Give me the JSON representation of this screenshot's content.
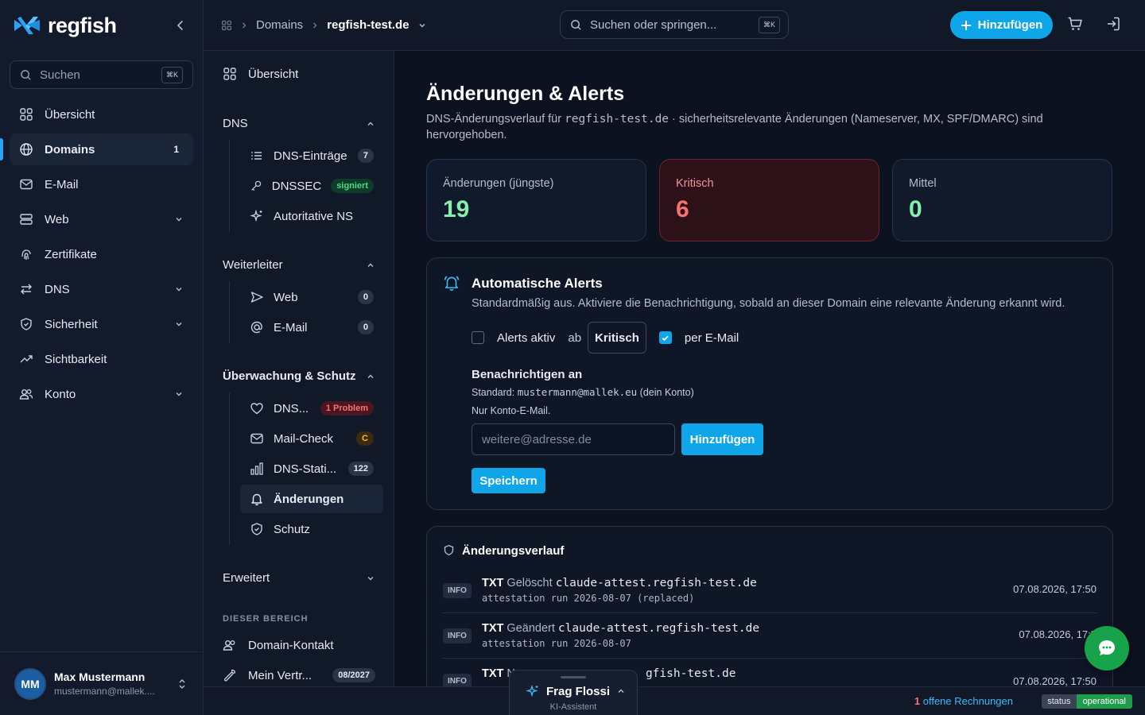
{
  "app": {
    "logo_text": "regfish"
  },
  "sidebar": {
    "search_placeholder": "Suchen",
    "search_kbd": "⌘K",
    "items": [
      {
        "label": "Übersicht",
        "icon": "grid-icon"
      },
      {
        "label": "Domains",
        "icon": "globe-icon",
        "badge": "1",
        "active": true
      },
      {
        "label": "E-Mail",
        "icon": "mail-icon"
      },
      {
        "label": "Web",
        "icon": "server-icon",
        "expandable": true
      },
      {
        "label": "Zertifikate",
        "icon": "fingerprint-icon"
      },
      {
        "label": "DNS",
        "icon": "arrows-icon",
        "expandable": true
      },
      {
        "label": "Sicherheit",
        "icon": "shield-icon",
        "expandable": true
      },
      {
        "label": "Sichtbarkeit",
        "icon": "trend-icon"
      },
      {
        "label": "Konto",
        "icon": "users-icon",
        "expandable": true
      }
    ],
    "user": {
      "initials": "MM",
      "name": "Max Mustermann",
      "email": "mustermann@mallek...."
    }
  },
  "topbar": {
    "breadcrumb_root": "Domains",
    "breadcrumb_current": "regfish-test.de",
    "search_placeholder": "Suchen oder springen...",
    "search_kbd": "⌘K",
    "add_button": "Hinzufügen"
  },
  "subnav": {
    "overview": "Übersicht",
    "dns_group": "DNS",
    "dns_entries": {
      "label": "DNS-Einträge",
      "badge": "7"
    },
    "dnssec": {
      "label": "DNSSEC",
      "badge": "signiert"
    },
    "auth_ns": {
      "label": "Autoritative NS"
    },
    "forward_group": "Weiterleiter",
    "forward_web": {
      "label": "Web",
      "badge": "0"
    },
    "forward_mail": {
      "label": "E-Mail",
      "badge": "0"
    },
    "monitor_group": "Überwachung & Schutz",
    "dns_health": {
      "label": "DNS...",
      "badge": "1 Problem"
    },
    "mail_check": {
      "label": "Mail-Check",
      "badge": "C"
    },
    "dns_stats": {
      "label": "DNS-Stati...",
      "badge": "122"
    },
    "changes": {
      "label": "Änderungen"
    },
    "protection": {
      "label": "Schutz"
    },
    "advanced_group": "Erweitert",
    "section_label": "DIESER BEREICH",
    "domain_contact": "Domain-Kontakt",
    "contract": {
      "label": "Mein Vertr...",
      "badge": "08/2027"
    }
  },
  "main": {
    "title": "Änderungen & Alerts",
    "lead_prefix": "DNS-Änderungsverlauf für ",
    "lead_domain": "regfish-test.de",
    "lead_suffix": " · sicherheitsrelevante Änderungen (Nameserver, MX, SPF/DMARC) sind hervorgehoben.",
    "stats": [
      {
        "label": "Änderungen (jüngste)",
        "value": "19",
        "color": "#86efac"
      },
      {
        "label": "Kritisch",
        "value": "6",
        "color": "#f87171"
      },
      {
        "label": "Mittel",
        "value": "0",
        "color": "#86efac"
      }
    ],
    "alerts": {
      "title": "Automatische Alerts",
      "subtitle": "Standardmäßig aus. Aktiviere die Benachrichtigung, sobald an dieser Domain eine relevante Änderung erkannt wird.",
      "active_label": "Alerts aktiv",
      "active_checked": false,
      "from_label": "ab",
      "severity_value": "Kritisch",
      "email_label": "per E-Mail",
      "email_checked": true,
      "notify_heading": "Benachrichtigen an",
      "default_prefix": "Standard: ",
      "default_email": "mustermann@mallek.eu",
      "default_suffix": " (dein Konto)",
      "only_account": "Nur Konto-E-Mail.",
      "input_placeholder": "weitere@adresse.de",
      "add_button": "Hinzufügen",
      "save_button": "Speichern"
    },
    "history": {
      "title": "Änderungsverlauf",
      "rows": [
        {
          "level": "INFO",
          "type": "TXT",
          "action": "Gelöscht",
          "record": "claude-attest.regfish-test.de",
          "detail": "attestation run 2026-08-07 (replaced)",
          "time": "07.08.2026, 17:50"
        },
        {
          "level": "INFO",
          "type": "TXT",
          "action": "Geändert",
          "record": "claude-attest.regfish-test.de",
          "detail": "attestation run 2026-08-07",
          "time": "07.08.2026, 17:5"
        },
        {
          "level": "INFO",
          "type": "TXT",
          "action": "N",
          "record": "gfish-test.de",
          "detail": "",
          "time": "07.08.2026, 17:50"
        }
      ]
    }
  },
  "footer": {
    "assistant_title": "Frag Flossi",
    "assistant_sub": "KI-Assistent",
    "invoices_count": "1",
    "invoices_label": " offene Rechnungen",
    "status_label": "status",
    "status_value": "operational"
  },
  "colors": {
    "accent": "#0ea5e9",
    "critical": "#f87171",
    "success": "#86efac",
    "chat": "#16a34a"
  }
}
